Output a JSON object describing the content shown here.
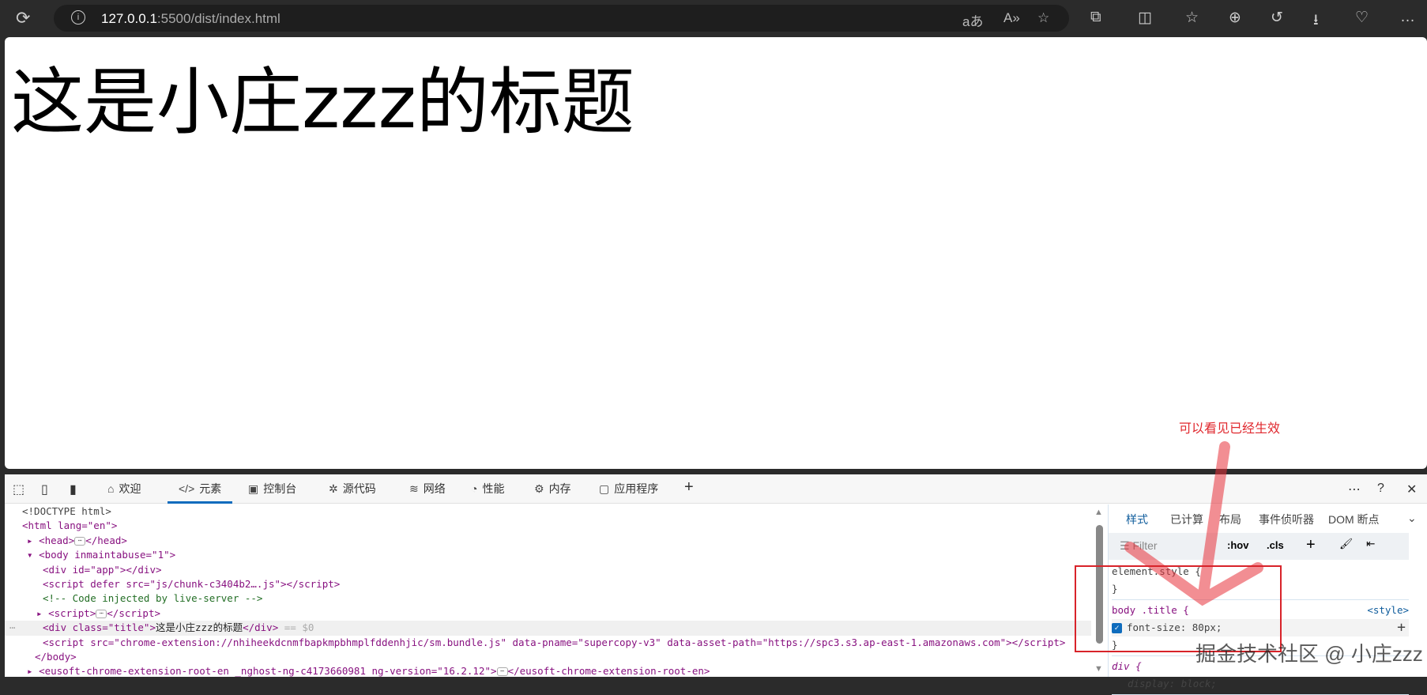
{
  "browser": {
    "url_host": "127.0.0.1",
    "url_rest": ":5500/dist/index.html"
  },
  "page": {
    "title": "这是小庄zzz的标题"
  },
  "devtools": {
    "tabs": [
      {
        "label": "欢迎",
        "icon": "home-icon"
      },
      {
        "label": "元素",
        "icon": "code-icon"
      },
      {
        "label": "控制台",
        "icon": "console-icon"
      },
      {
        "label": "源代码",
        "icon": "bug-icon"
      },
      {
        "label": "网络",
        "icon": "wifi-icon"
      },
      {
        "label": "性能",
        "icon": "gauge-icon"
      },
      {
        "label": "内存",
        "icon": "chip-icon"
      },
      {
        "label": "应用程序",
        "icon": "app-icon"
      }
    ],
    "dom": {
      "doctype": "<!DOCTYPE html>",
      "html_open": "<html lang=\"en\">",
      "head": "<head>",
      "head_close": "</head>",
      "body_open": "<body inmaintabuse=\"1\">",
      "div_app": "<div id=\"app\"></div>",
      "script_chunk": "<script defer src=\"js/chunk-c3404b2….js\"></script>",
      "comment": "<!-- Code injected by live-server -->",
      "script_open": "<script>",
      "script_close": "</script>",
      "div_title_open": "<div class=\"title\">",
      "div_title_text": "这是小庄zzz的标题",
      "div_title_close": "</div>",
      "selected_marker": "== $0",
      "script_ext": "<script src=\"chrome-extension://nhiheekdcnmfbapkmpbhmplfddenhjic/sm.bundle.js\" data-pname=\"supercopy-v3\" data-asset-path=\"https://spc3.s3.ap-east-1.amazonaws.com\"></script>",
      "body_close": "</body>",
      "eusoft_open": "<eusoft-chrome-extension-root-en _nghost-ng-c4173660981 ng-version=\"16.2.12\">",
      "eusoft_close": "</eusoft-chrome-extension-root-en>"
    },
    "styles": {
      "tabs": [
        "样式",
        "已计算",
        "布局",
        "事件侦听器",
        "DOM 断点"
      ],
      "filter_placeholder": "Filter",
      "hov": ":hov",
      "cls": ".cls",
      "element_style": "element.style {",
      "close_brace": "}",
      "rule_selector": "body .title {",
      "rule_source": "<style>",
      "rule_decl": "font-size: 80px;",
      "div_selector": "div {",
      "div_decl": "display: block;"
    }
  },
  "annotation": {
    "text": "可以看见已经生效",
    "color": "#e0282e"
  },
  "watermark": "掘金技术社区 @ 小庄zzz"
}
